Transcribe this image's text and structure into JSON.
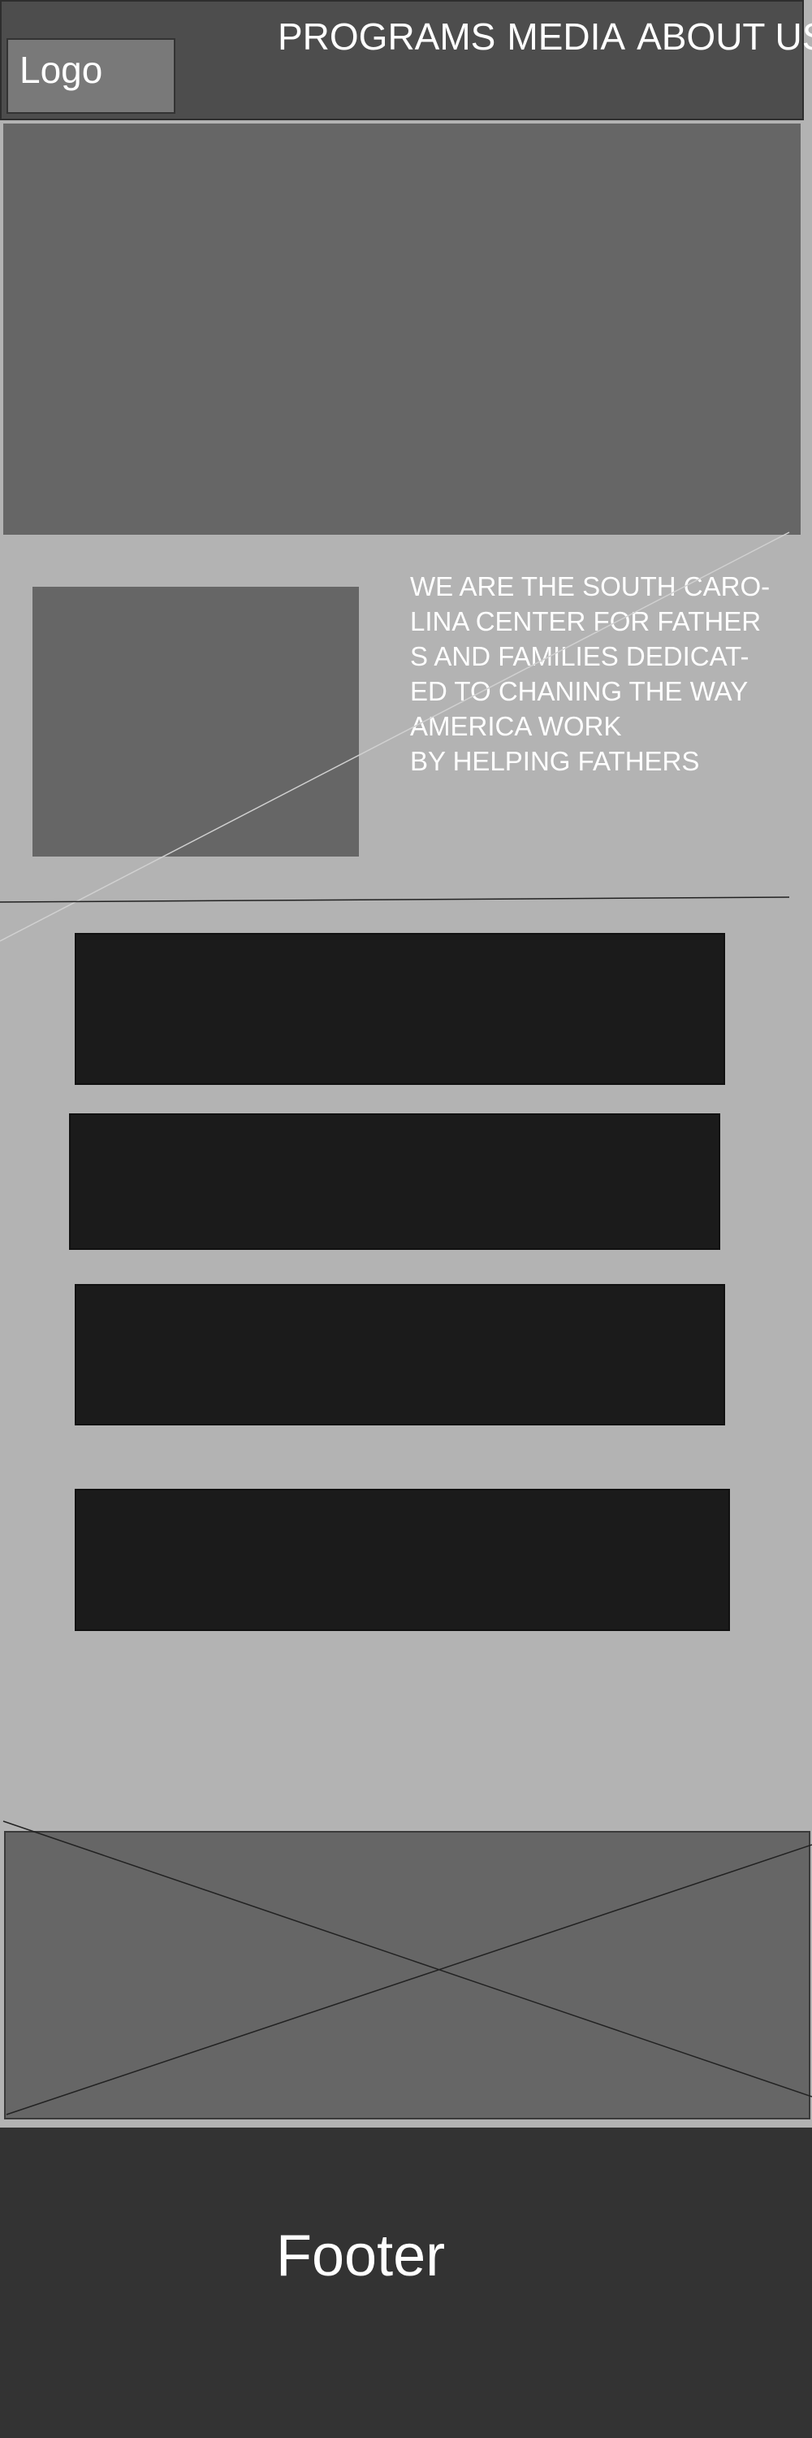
{
  "header": {
    "logo": "Logo",
    "nav": {
      "programs": "PROGRAMS",
      "media": "MEDIA",
      "about_us": "ABOUT US"
    }
  },
  "intro": {
    "text": "WE ARE THE SOUTH CARO-\nLINA CENTER FOR FATHER\nS AND FAMILIES DEDICAT-\nED TO CHANING THE  WAY\nAMERICA WORK\nBY HELPING FATHERS"
  },
  "footer": {
    "label": "Footer"
  },
  "colors": {
    "page_background": "#b3b3b3",
    "header_background": "#4d4d4d",
    "placeholder_gray": "#666666",
    "card_dark": "#1b1b1b",
    "footer_background": "#333333",
    "text_white": "#ffffff"
  }
}
